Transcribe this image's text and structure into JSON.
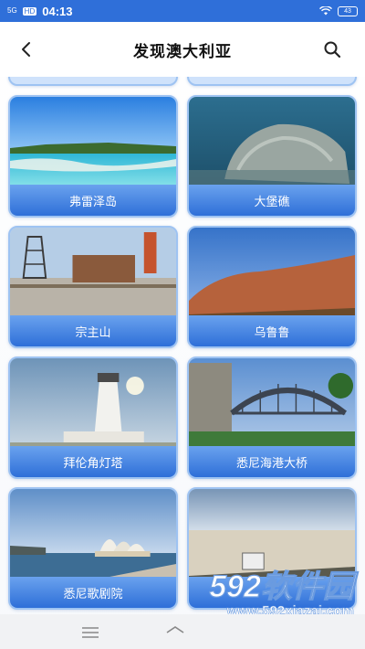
{
  "status_bar": {
    "signal": "5G",
    "hd": "HD",
    "time": "04:13",
    "battery": "43"
  },
  "header": {
    "title": "发现澳大利亚",
    "back_icon": "back-arrow-icon",
    "search_icon": "search-icon"
  },
  "places": [
    {
      "name": "弗雷泽岛"
    },
    {
      "name": "大堡礁"
    },
    {
      "name": "宗主山"
    },
    {
      "name": "乌鲁鲁"
    },
    {
      "name": "拜伦角灯塔"
    },
    {
      "name": "悉尼海港大桥"
    },
    {
      "name": "悉尼歌剧院"
    }
  ],
  "watermark": {
    "logo": "592软件园",
    "url": "www.592xiazai.com"
  },
  "colors": {
    "accent": "#2f6fd9",
    "card_label": "#2e6fd8",
    "card_border": "#9ec3f2"
  }
}
